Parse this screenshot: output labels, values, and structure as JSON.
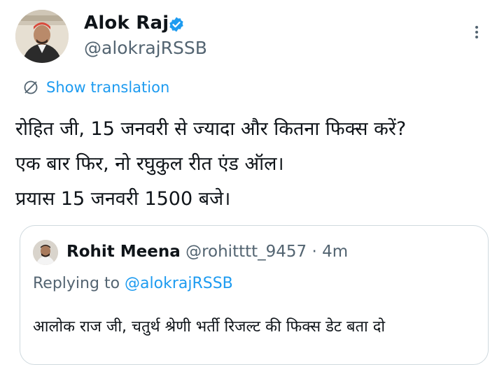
{
  "author": {
    "name": "Alok Raj",
    "handle": "@alokrajRSSB",
    "verified": true
  },
  "translate_label": "Show translation",
  "tweet_lines": [
    "रोहित जी, 15 जनवरी से ज्यादा और कितना फिक्स करें?",
    "एक बार फिर, नो रघुकुल रीत एंड ऑल।",
    "प्रयास 15 जनवरी 1500 बजे।"
  ],
  "quote": {
    "name": "Rohit Meena",
    "handle": "@rohitttt_9457",
    "separator": "·",
    "time": "4m",
    "replying_prefix": "Replying to",
    "replying_to": "@alokrajRSSB",
    "text": "आलोक राज जी, चतुर्थ श्रेणी भर्ती रिजल्ट की फिक्स डेट बता दो"
  },
  "colors": {
    "accent": "#1d9bf0",
    "secondary_text": "#536471",
    "border": "#cfd9de"
  },
  "icons": [
    "verified-badge-icon",
    "more-options-icon",
    "translate-icon"
  ]
}
